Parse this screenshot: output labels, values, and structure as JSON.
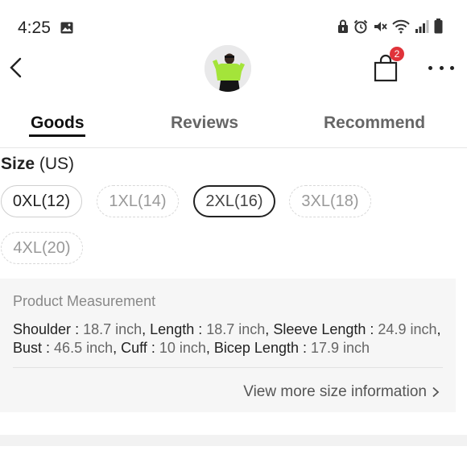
{
  "status_bar": {
    "time": "4:25"
  },
  "header": {
    "bag_badge": "2"
  },
  "tabs": [
    {
      "label": "Goods",
      "active": true
    },
    {
      "label": "Reviews",
      "active": false
    },
    {
      "label": "Recommend",
      "active": false
    }
  ],
  "size": {
    "title_bold": "Size",
    "title_unit": "(US)",
    "options": [
      {
        "label": "0XL(12)",
        "state": "available"
      },
      {
        "label": "1XL(14)",
        "state": "disabled"
      },
      {
        "label": "2XL(16)",
        "state": "selected"
      },
      {
        "label": "3XL(18)",
        "state": "disabled"
      },
      {
        "label": "4XL(20)",
        "state": "disabled"
      }
    ]
  },
  "measurement": {
    "title": "Product Measurement",
    "items": [
      {
        "name": "Shoulder",
        "value": "18.7 inch"
      },
      {
        "name": "Length",
        "value": "18.7 inch"
      },
      {
        "name": "Sleeve Length",
        "value": "24.9 inch"
      },
      {
        "name": "Bust",
        "value": "46.5 inch"
      },
      {
        "name": "Cuff",
        "value": "10 inch"
      },
      {
        "name": "Bicep Length",
        "value": "17.9 inch"
      }
    ],
    "view_more": "View more size information"
  }
}
